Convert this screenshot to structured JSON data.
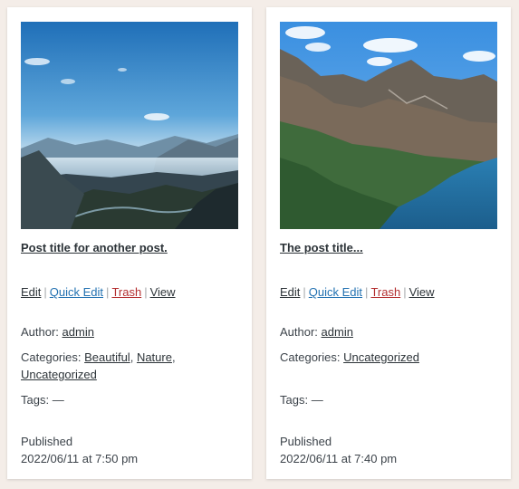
{
  "posts": [
    {
      "title": "Post title for another post.",
      "image": "mountain-valley-mist-photo",
      "actions": {
        "edit": "Edit",
        "quick_edit": "Quick Edit",
        "trash": "Trash",
        "view": "View",
        "separator": "|"
      },
      "author_label": "Author:",
      "author": "admin",
      "categories_label": "Categories:",
      "categories": [
        "Beautiful",
        "Nature",
        "Uncategorized"
      ],
      "tags_label": "Tags:",
      "tags_value": "—",
      "status": "Published",
      "date": "2022/06/11 at 7:50 pm"
    },
    {
      "title": "The post title...",
      "image": "mountain-lake-photo",
      "actions": {
        "edit": "Edit",
        "quick_edit": "Quick Edit",
        "trash": "Trash",
        "view": "View",
        "separator": "|"
      },
      "author_label": "Author:",
      "author": "admin",
      "categories_label": "Categories:",
      "categories": [
        "Uncategorized"
      ],
      "tags_label": "Tags:",
      "tags_value": "—",
      "status": "Published",
      "date": "2022/06/11 at 7:40 pm"
    }
  ],
  "colors": {
    "background": "#f4ede8",
    "card": "#ffffff",
    "link_dark": "#2c3338",
    "link_blue": "#2271b1",
    "link_red": "#b32d2e",
    "separator": "#a7aaad"
  }
}
